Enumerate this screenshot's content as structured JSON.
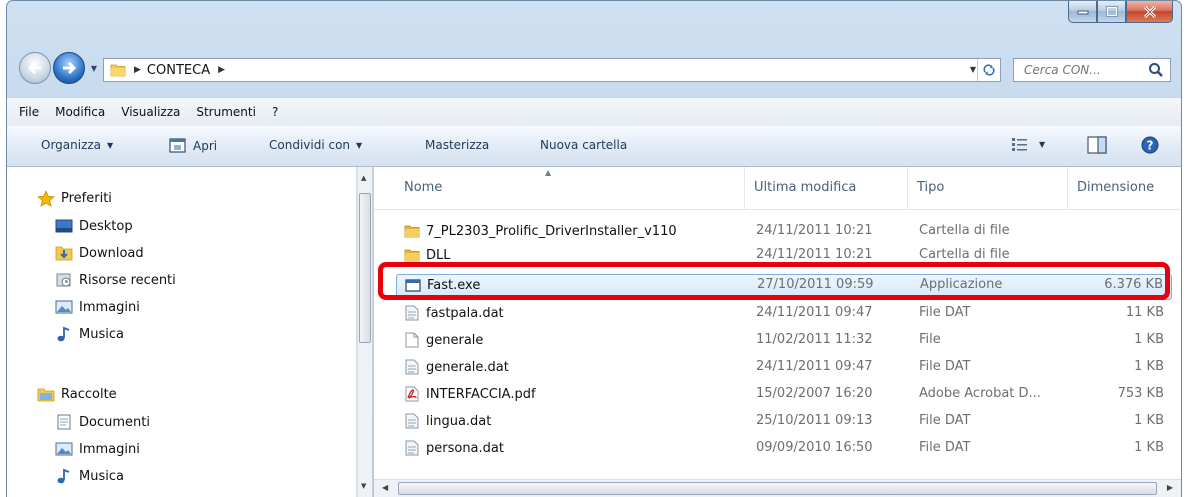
{
  "address": {
    "crumb": "CONTECA",
    "search_placeholder": "Cerca CON..."
  },
  "menu": [
    "File",
    "Modifica",
    "Visualizza",
    "Strumenti",
    "?"
  ],
  "toolbar": {
    "organize": "Organizza",
    "open": "Apri",
    "share": "Condividi con",
    "burn": "Masterizza",
    "new_folder": "Nuova cartella"
  },
  "sidebar": {
    "favorites": "Preferiti",
    "desktop": "Desktop",
    "download": "Download",
    "recent": "Risorse recenti",
    "images": "Immagini",
    "music": "Musica",
    "collections": "Raccolte",
    "documents": "Documenti",
    "images2": "Immagini",
    "music2": "Musica"
  },
  "columns": {
    "name": "Nome",
    "modified": "Ultima modifica",
    "type": "Tipo",
    "size": "Dimensione"
  },
  "files": [
    {
      "name": "7_PL2303_Prolific_DriverInstaller_v110",
      "date": "24/11/2011 10:21",
      "type": "Cartella di file",
      "size": "",
      "icon": "folder-icon"
    },
    {
      "name": "DLL",
      "date": "24/11/2011 10:21",
      "type": "Cartella di file",
      "size": "",
      "icon": "folder-icon"
    },
    {
      "name": "Fast.exe",
      "date": "27/10/2011 09:59",
      "type": "Applicazione",
      "size": "6.376 KB",
      "icon": "application-icon",
      "selected": true
    },
    {
      "name": "fastpala.dat",
      "date": "24/11/2011 09:47",
      "type": "File DAT",
      "size": "11 KB",
      "icon": "dat-file-icon"
    },
    {
      "name": "generale",
      "date": "11/02/2011 11:32",
      "type": "File",
      "size": "1 KB",
      "icon": "file-icon"
    },
    {
      "name": "generale.dat",
      "date": "24/11/2011 09:47",
      "type": "File DAT",
      "size": "1 KB",
      "icon": "dat-file-icon"
    },
    {
      "name": "INTERFACCIA.pdf",
      "date": "15/02/2007 16:20",
      "type": "Adobe Acrobat D...",
      "size": "753 KB",
      "icon": "pdf-icon"
    },
    {
      "name": "lingua.dat",
      "date": "25/10/2011 09:13",
      "type": "File DAT",
      "size": "1 KB",
      "icon": "dat-file-icon"
    },
    {
      "name": "persona.dat",
      "date": "09/09/2010 16:50",
      "type": "File DAT",
      "size": "1 KB",
      "icon": "dat-file-icon"
    }
  ],
  "colors": {
    "highlight": "#e8000b",
    "selection_border": "#7daee2",
    "link_blue": "#1e395b"
  }
}
